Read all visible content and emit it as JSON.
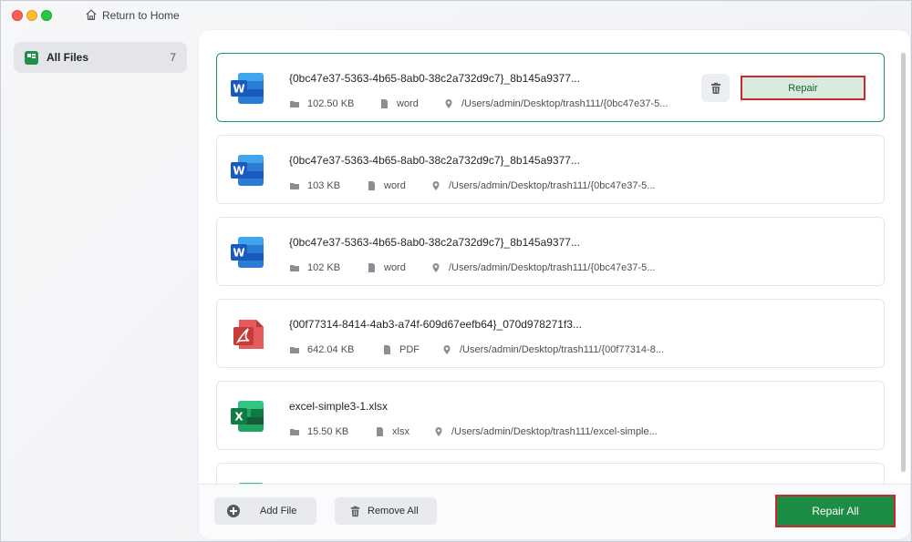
{
  "titlebar": {
    "home_label": "Return to Home"
  },
  "sidebar": {
    "items": [
      {
        "label": "All Files",
        "count": "7",
        "icon": "file-category-icon"
      }
    ]
  },
  "files": [
    {
      "name": "{0bc47e37-5363-4b65-8ab0-38c2a732d9c7}_8b145a9377...",
      "size": "102.50 KB",
      "type": "word",
      "path": "/Users/admin/Desktop/trash111/{0bc47e37-5...",
      "icon": "word-icon",
      "repair_label": "Repair"
    },
    {
      "name": "{0bc47e37-5363-4b65-8ab0-38c2a732d9c7}_8b145a9377...",
      "size": "103 KB",
      "type": "word",
      "path": "/Users/admin/Desktop/trash111/{0bc47e37-5...",
      "icon": "word-icon"
    },
    {
      "name": "{0bc47e37-5363-4b65-8ab0-38c2a732d9c7}_8b145a9377...",
      "size": "102 KB",
      "type": "word",
      "path": "/Users/admin/Desktop/trash111/{0bc47e37-5...",
      "icon": "word-icon"
    },
    {
      "name": "{00f77314-8414-4ab3-a74f-609d67eefb64}_070d978271f3...",
      "size": "642.04 KB",
      "type": "PDF",
      "path": "/Users/admin/Desktop/trash111/{00f77314-8...",
      "icon": "pdf-icon"
    },
    {
      "name": "excel-simple3-1.xlsx",
      "size": "15.50 KB",
      "type": "xlsx",
      "path": "/Users/admin/Desktop/trash111/excel-simple...",
      "icon": "excel-icon"
    }
  ],
  "footer": {
    "add_label": "Add File",
    "remove_label": "Remove All",
    "repair_all_label": "Repair All"
  },
  "colors": {
    "accent": "#1d8d45",
    "highlight_border": "#d0262d"
  }
}
